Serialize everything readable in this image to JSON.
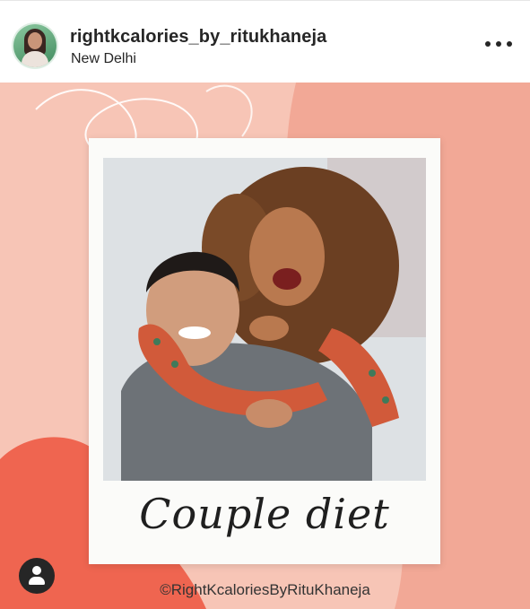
{
  "header": {
    "username": "rightkcalories_by_ritukhaneja",
    "location": "New Delhi",
    "more_icon": "more-horizontal-icon"
  },
  "post": {
    "caption": "Couple diet",
    "copyright": "©RightKcaloriesByRituKhaneja",
    "tag_icon": "user-tag-icon",
    "colors": {
      "background": "#f7c5b6",
      "accent_shape": "#f2a896",
      "blob": "#ef6550",
      "frame": "#fbfbf9"
    }
  }
}
